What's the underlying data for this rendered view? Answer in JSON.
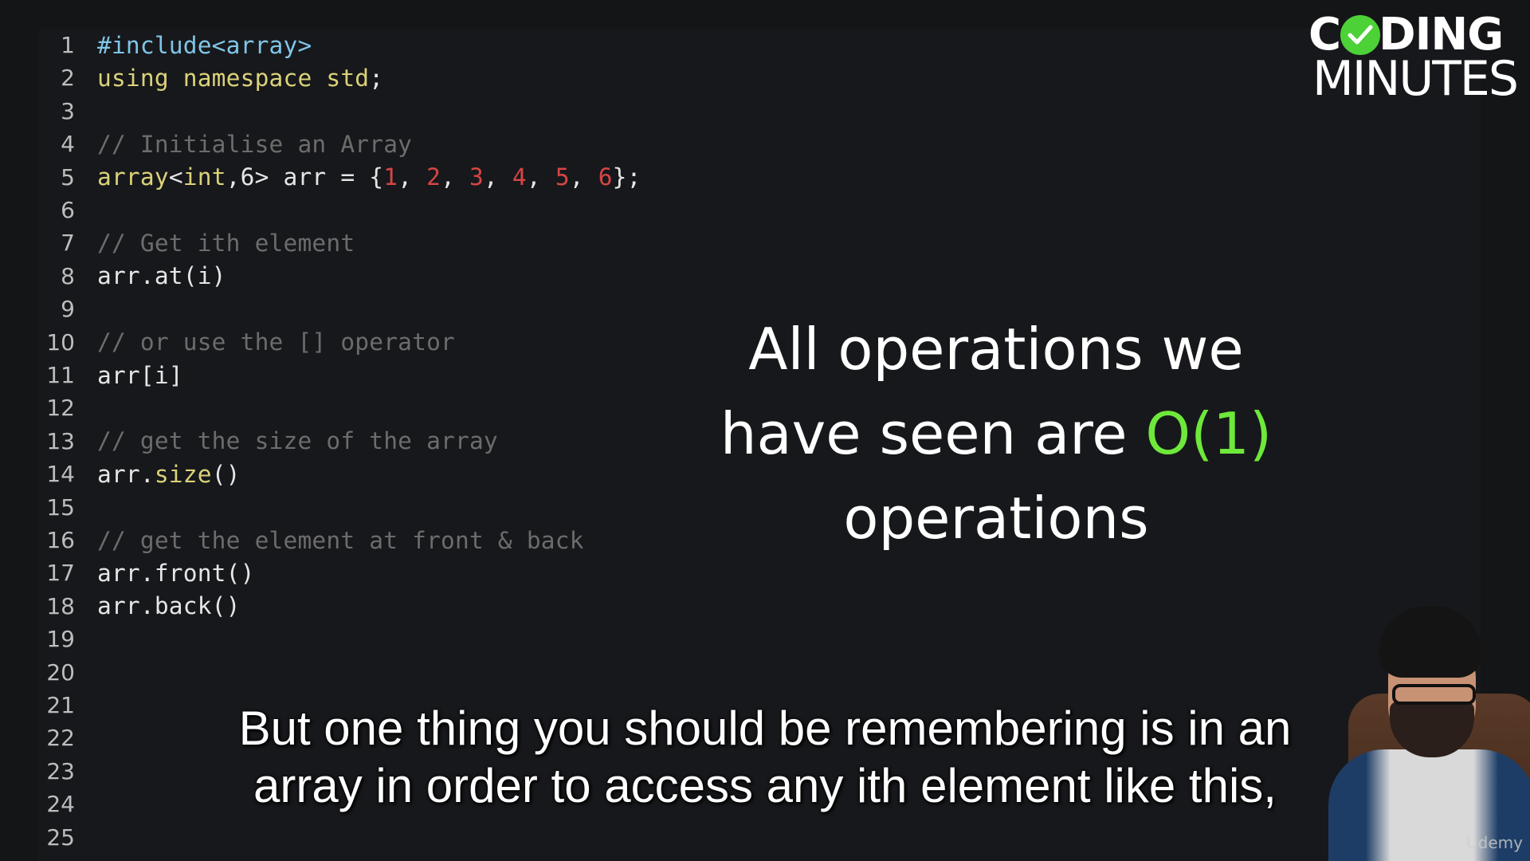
{
  "editor": {
    "lines": [
      {
        "n": "1",
        "tokens": [
          {
            "t": "#include<array>",
            "c": "inc"
          }
        ]
      },
      {
        "n": "2",
        "tokens": [
          {
            "t": "using namespace std",
            "c": "kw"
          },
          {
            "t": ";",
            "c": "pl"
          }
        ]
      },
      {
        "n": "3",
        "tokens": []
      },
      {
        "n": "4",
        "tokens": [
          {
            "t": "// Initialise an Array",
            "c": "cm"
          }
        ]
      },
      {
        "n": "5",
        "tokens": [
          {
            "t": "array",
            "c": "kw"
          },
          {
            "t": "<",
            "c": "pl"
          },
          {
            "t": "int",
            "c": "kw"
          },
          {
            "t": ",6> arr = {",
            "c": "pl"
          },
          {
            "t": "1",
            "c": "num"
          },
          {
            "t": ", ",
            "c": "pl"
          },
          {
            "t": "2",
            "c": "num"
          },
          {
            "t": ", ",
            "c": "pl"
          },
          {
            "t": "3",
            "c": "num"
          },
          {
            "t": ", ",
            "c": "pl"
          },
          {
            "t": "4",
            "c": "num"
          },
          {
            "t": ", ",
            "c": "pl"
          },
          {
            "t": "5",
            "c": "num"
          },
          {
            "t": ", ",
            "c": "pl"
          },
          {
            "t": "6",
            "c": "num"
          },
          {
            "t": "};",
            "c": "pl"
          }
        ]
      },
      {
        "n": "6",
        "tokens": []
      },
      {
        "n": "7",
        "tokens": [
          {
            "t": "// Get ith element",
            "c": "cm"
          }
        ]
      },
      {
        "n": "8",
        "tokens": [
          {
            "t": "arr.at(i)",
            "c": "pl"
          }
        ]
      },
      {
        "n": "9",
        "tokens": []
      },
      {
        "n": "10",
        "tokens": [
          {
            "t": "// or use the [] operator",
            "c": "cm"
          }
        ]
      },
      {
        "n": "11",
        "tokens": [
          {
            "t": "arr[i]",
            "c": "pl"
          }
        ]
      },
      {
        "n": "12",
        "tokens": []
      },
      {
        "n": "13",
        "tokens": [
          {
            "t": "// get the size of the array",
            "c": "cm"
          }
        ]
      },
      {
        "n": "14",
        "tokens": [
          {
            "t": "arr.",
            "c": "pl"
          },
          {
            "t": "size",
            "c": "fn"
          },
          {
            "t": "()",
            "c": "pl"
          }
        ]
      },
      {
        "n": "15",
        "tokens": []
      },
      {
        "n": "16",
        "tokens": [
          {
            "t": "// get the element at front & back",
            "c": "cm"
          }
        ]
      },
      {
        "n": "17",
        "tokens": [
          {
            "t": "arr.front()",
            "c": "pl"
          }
        ]
      },
      {
        "n": "18",
        "tokens": [
          {
            "t": "arr.back()",
            "c": "pl"
          }
        ]
      },
      {
        "n": "19",
        "tokens": []
      },
      {
        "n": "20",
        "tokens": []
      },
      {
        "n": "21",
        "tokens": []
      },
      {
        "n": "22",
        "tokens": []
      },
      {
        "n": "23",
        "tokens": []
      },
      {
        "n": "24",
        "tokens": []
      },
      {
        "n": "25",
        "tokens": []
      }
    ]
  },
  "logo": {
    "top_left": "C",
    "top_right": "DING",
    "bottom": "MINUTES",
    "check_icon": "check-circle-icon",
    "check_color": "#4cd137"
  },
  "overlay": {
    "line1": "All operations we",
    "line2_prefix": "have seen are ",
    "line2_highlight": "O(1)",
    "line3": "operations",
    "highlight_color": "#6ee83a"
  },
  "subtitle": {
    "line1": "But one thing you should be remembering is in an",
    "line2": "array in order to access any ith element like this,"
  },
  "watermark": "Udemy"
}
